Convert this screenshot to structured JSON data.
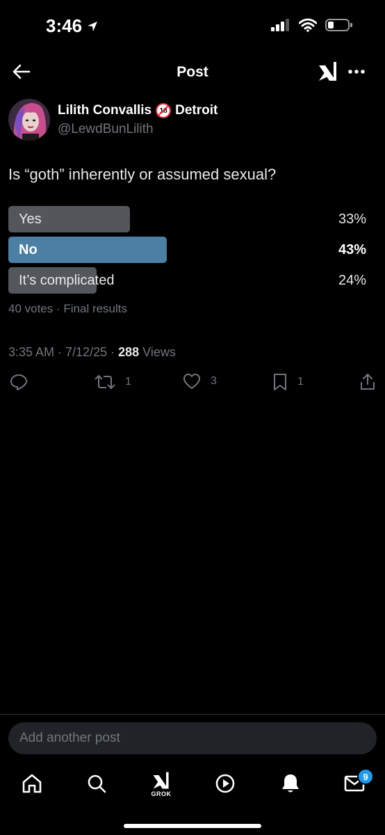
{
  "status": {
    "time": "3:46"
  },
  "nav": {
    "title": "Post"
  },
  "post": {
    "author_name": "Lilith Convallis",
    "author_suffix": "Detroit",
    "handle": "@LewdBunLilith",
    "text": "Is “goth” inherently or assumed sexual?",
    "poll": {
      "options": [
        {
          "label": "Yes",
          "percent": "33%",
          "fraction": 0.33
        },
        {
          "label": "No",
          "percent": "43%",
          "fraction": 0.43,
          "winner": true
        },
        {
          "label": "It’s complicated",
          "percent": "24%",
          "fraction": 0.24
        }
      ],
      "meta": "40 votes · Final results"
    },
    "timestamp": "3:35 AM · 7/12/25 · ",
    "views_count": "288",
    "views_label": " Views",
    "actions": {
      "reply": "",
      "repost": "1",
      "like": "3",
      "bookmark": "1"
    }
  },
  "composer": {
    "placeholder": "Add another post"
  },
  "tabbar": {
    "grok_label": "GROK",
    "messages_badge": "9"
  },
  "colors": {
    "winner_bar": "#4b7fa3",
    "bar": "#53575b",
    "accent": "#1d9bf0"
  }
}
